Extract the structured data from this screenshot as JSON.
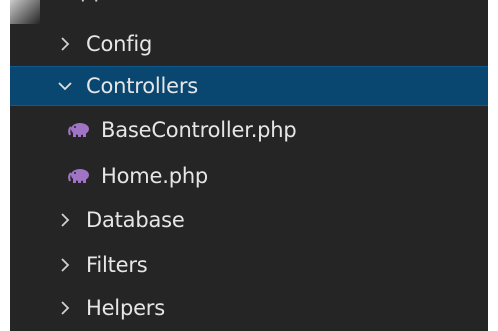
{
  "explorer": {
    "parent_label_clipped": "pp",
    "items": [
      {
        "label": "Config",
        "kind": "folder",
        "state": "collapsed",
        "icon": "chevron-right-icon"
      },
      {
        "label": "Controllers",
        "kind": "folder",
        "state": "expanded",
        "icon": "chevron-down-icon",
        "selected": true
      },
      {
        "label": "BaseController.php",
        "kind": "file",
        "icon": "php-elephant-icon"
      },
      {
        "label": "Home.php",
        "kind": "file",
        "icon": "php-elephant-icon"
      },
      {
        "label": "Database",
        "kind": "folder",
        "state": "collapsed",
        "icon": "chevron-right-icon"
      },
      {
        "label": "Filters",
        "kind": "folder",
        "state": "collapsed",
        "icon": "chevron-right-icon"
      },
      {
        "label": "Helpers",
        "kind": "folder",
        "state": "collapsed",
        "icon": "chevron-right-icon"
      }
    ]
  },
  "colors": {
    "background": "#252526",
    "selection": "#094771",
    "text": "#e6e6e6",
    "php_icon": "#a074c4"
  }
}
